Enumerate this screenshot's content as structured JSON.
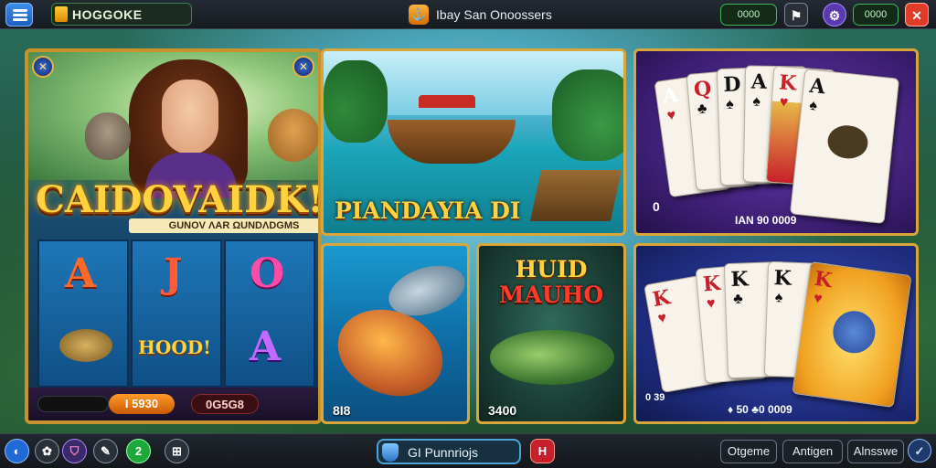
{
  "top_bar": {
    "brand": "HOGGOKE",
    "title": "Ibay San Onoossers",
    "title_icon_glyph": "⚓",
    "pill_left": "0000",
    "pill_right": "0000",
    "flag_glyph": "⚑",
    "gear_glyph": "⚙",
    "close_glyph": "✕",
    "accent": "#41b65a",
    "close_color": "#e23b2a"
  },
  "hero": {
    "logo": "CAIDOVAIDK!",
    "subtitle": "GUNOV ΛAR ΩUNDΛDGMS",
    "corner_glyph": "✕",
    "reel_symbols": [
      "A",
      "J",
      "O",
      "HOOD!",
      "A"
    ],
    "amount_1": "I 5930",
    "amount_2": "0G5G8"
  },
  "tiles": {
    "boat_title": "PIANDAYIA DI",
    "cards1_count": "0",
    "cards1_amount": "IAN 90 0009",
    "cards1_hand": [
      {
        "rank": "A",
        "suit": "♥",
        "color": "#c8202a"
      },
      {
        "rank": "Q",
        "suit": "♣",
        "color": "#c8202a"
      },
      {
        "rank": "D",
        "suit": "♠",
        "color": "#111111"
      },
      {
        "rank": "A",
        "suit": "♠",
        "color": "#111111"
      },
      {
        "rank": "K",
        "suit": "♥",
        "color": "#c8202a"
      },
      {
        "rank": "A",
        "suit": "♠",
        "color": "#111111"
      }
    ],
    "fish1_amount": "8I8",
    "fish2_title_1": "HUID",
    "fish2_title_2": "MAUHO",
    "fish2_amount": "3400",
    "cards2_amount_left": "0 39",
    "cards2_amount": "♦ 50 ♣0 0009",
    "cards2_hand": [
      {
        "rank": "K",
        "suit": "♥",
        "color": "#c8202a"
      },
      {
        "rank": "K",
        "suit": "♥",
        "color": "#c8202a"
      },
      {
        "rank": "K",
        "suit": "♣",
        "color": "#111111"
      },
      {
        "rank": "K",
        "suit": "♠",
        "color": "#111111"
      },
      {
        "rank": "K",
        "suit": "♥",
        "color": "#c8202a"
      }
    ]
  },
  "bottom_bar": {
    "icon_1": "◐",
    "icon_2": "✿",
    "icon_3": "⛉",
    "icon_4": "✎",
    "icon_5": "2",
    "icon_6": "⊞",
    "search_text": "GI Punnriojs",
    "red_glyph": "H",
    "btn_1": "Otgeme",
    "btn_2": "Antigen",
    "btn_3": "Alnsswe",
    "check_glyph": "✓"
  }
}
